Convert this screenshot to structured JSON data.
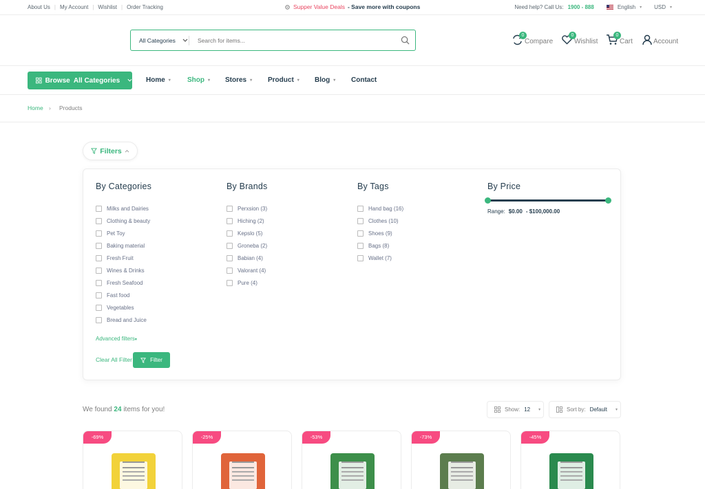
{
  "topbar": {
    "links": [
      "About Us",
      "My Account",
      "Wishlist",
      "Order Tracking"
    ],
    "promo_red": "Supper Value Deals",
    "promo_dark": "- Save more with coupons",
    "help": "Need help? Call Us:",
    "phone": "1900 - 888",
    "language": "English",
    "currency": "USD"
  },
  "search": {
    "category": "All Categories",
    "placeholder": "Search for items..."
  },
  "header_actions": {
    "compare": {
      "label": "Compare",
      "count": "0"
    },
    "wishlist": {
      "label": "Wishlist",
      "count": "0"
    },
    "cart": {
      "label": "Cart",
      "count": "0"
    },
    "account": {
      "label": "Account"
    }
  },
  "nav": {
    "browse": "Browse  All Categories",
    "items": [
      "Home",
      "Shop",
      "Stores",
      "Product",
      "Blog",
      "Contact"
    ]
  },
  "breadcrumb": {
    "home": "Home",
    "current": "Products"
  },
  "filters": {
    "toggle": "Filters",
    "categories_title": "By Categories",
    "categories": [
      "Milks and Dairies",
      "Clothing & beauty",
      "Pet Toy",
      "Baking material",
      "Fresh Fruit",
      "Wines & Drinks",
      "Fresh Seafood",
      "Fast food",
      "Vegetables",
      "Bread and Juice"
    ],
    "brands_title": "By Brands",
    "brands": [
      "Perxsion (3)",
      "Hiching (2)",
      "Kepslo (5)",
      "Groneba (2)",
      "Babian (4)",
      "Valorant (4)",
      "Pure (4)"
    ],
    "tags_title": "By Tags",
    "tags": [
      "Hand bag (16)",
      "Clothes (10)",
      "Shoes (9)",
      "Bags (8)",
      "Wallet (7)"
    ],
    "price_title": "By Price",
    "range_label": "Range:",
    "range_min": "$0.00",
    "range_max": "- $100,000.00",
    "advanced": "Advanced filters",
    "clear": "Clear All Filter",
    "apply": "Filter"
  },
  "results": {
    "found_prefix": "We found",
    "count": "24",
    "found_suffix": "items for you!",
    "show_label": "Show:",
    "show_value": "12",
    "sort_label": "Sort by:",
    "sort_value": "Default"
  },
  "products": [
    {
      "discount": "-69%",
      "color": "#f2d23a"
    },
    {
      "discount": "-25%",
      "color": "#e0643a"
    },
    {
      "discount": "-53%",
      "color": "#3d8f4a"
    },
    {
      "discount": "-73%",
      "color": "#5c7d4e"
    },
    {
      "discount": "-45%",
      "color": "#2a8a4e"
    }
  ],
  "colors": {
    "accent": "#3bb77e",
    "badge": "#f74b81",
    "promo": "#e94560",
    "text": "#253d4e"
  }
}
